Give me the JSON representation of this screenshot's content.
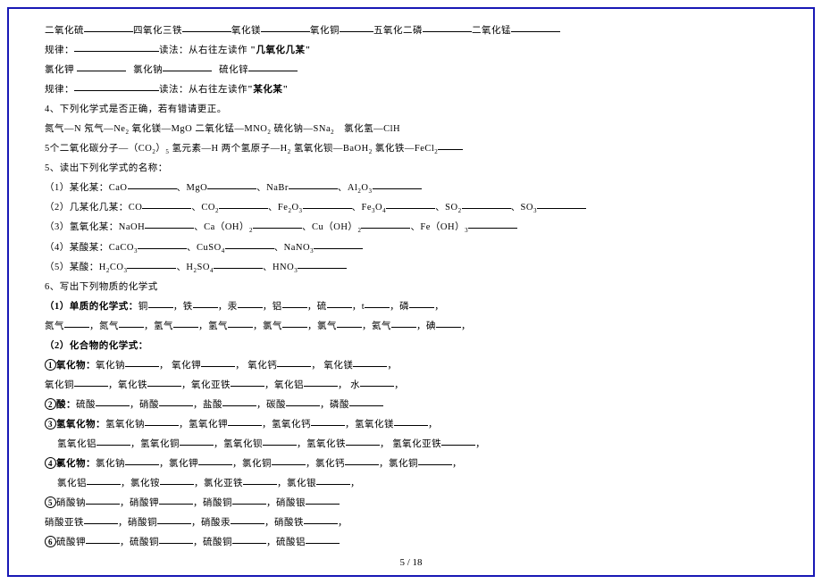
{
  "r1": {
    "a": "二氧化硫",
    "b": "四氧化三铁",
    "c": "氧化镁",
    "d": "氧化铜",
    "e": "五氧化二磷",
    "f": "二氧化锰"
  },
  "r2": {
    "a": "规律：",
    "b": "读法：从右往左读作",
    "c": "\"几氧化几某\""
  },
  "r3": {
    "a": "氯化钾",
    "b": "氯化钠",
    "c": "硫化锌"
  },
  "r4": {
    "a": "规律：",
    "b": "读法：从右往左读作",
    "c": "\"某化某\""
  },
  "r5": "4、下列化学式是否正确，若有错请更正。",
  "r6": {
    "a": "氮气—N",
    "b": "氖气—Ne",
    "c": "氧化镁—MgO",
    "d": "二氧化锰—MNO",
    "e": "硫化钠—SNa",
    "f": "氯化氢—ClH"
  },
  "r7": {
    "a": "5个二氧化碳分子—（CO",
    "b": "）",
    "c": " 氢元素—H 两个氢原子—H",
    "d": "氢氧化钡—BaOH",
    "e": "氯化铁—FeCl"
  },
  "r8": "5、读出下列化学式的名称：",
  "r9": {
    "a": "（1）某化某：CaO",
    "b": "、MgO",
    "c": "、NaBr",
    "d": "、Al",
    "e": "O"
  },
  "r10": {
    "a": "（2）几某化几某：CO",
    "b": "、CO",
    "c": "、Fe",
    "d": "O",
    "e": "、Fe",
    "f": "O",
    "g": "、SO",
    "h": "、SO"
  },
  "r11": {
    "a": "（3）氢氧化某：NaOH",
    "b": "、Ca（OH）",
    "c": "、Cu（OH）",
    "d": "、Fe（OH）"
  },
  "r12": {
    "a": "（4）某酸某：CaCO",
    "b": "、CuSO",
    "c": "、NaNO"
  },
  "r13": {
    "a": "（5）某酸：H",
    "b": "CO",
    "c": "、H",
    "d": "SO",
    "e": "、HNO"
  },
  "r14": "6、写出下列物质的化学式",
  "r15": {
    "a": "（1）单质的化学式：",
    "b": "铜",
    "c": "，铁",
    "d": "，汞",
    "e": "，铝",
    "f": "，硫",
    "g": "，t",
    "h": "，磷",
    "i": "，"
  },
  "r16": {
    "a": "氮气",
    "b": "，氮气",
    "c": "，氢气",
    "d": "，氢气",
    "e": "，氯气",
    "f": "，氯气",
    "g": "，氦气",
    "h": "，碘",
    "i": "，"
  },
  "r17": "（2）化合物的化学式：",
  "r18": {
    "a": "氧化物：",
    "b": "氧化钠",
    "c": "，  氧化钾",
    "d": "，  氧化钙",
    "e": "，     氧化镁",
    "f": "，"
  },
  "r19": {
    "a": "氧化铜",
    "b": "，氧化铁",
    "c": "，氧化亚铁",
    "d": "，氧化铝",
    "e": "，  水",
    "f": "，"
  },
  "r20": {
    "a": "酸：",
    "b": "硫酸",
    "c": "，硝酸",
    "d": "，盐酸",
    "e": "，碳酸",
    "f": "，磷酸"
  },
  "r21": {
    "a": "氢氧化物：",
    "b": "氢氧化钠",
    "c": "，氢氧化钾",
    "d": "，氢氧化钙",
    "e": "，氢氧化镁",
    "f": "，"
  },
  "r22": {
    "a": " 氢氧化铝",
    "b": "，氢氧化铜",
    "c": "，氢氧化钡",
    "d": "，氢氧化铁",
    "e": "，  氢氧化亚铁",
    "f": "，"
  },
  "r23": {
    "a": "氯化物：",
    "b": "氯化钠",
    "c": "，氯化钾",
    "d": "，氯化铜",
    "e": "，氯化钙",
    "f": "，氯化铜",
    "g": "，"
  },
  "r24": {
    "a": "  氯化铝",
    "b": "，氯化铵",
    "c": "，氯化亚铁",
    "d": "，氯化银",
    "e": "，"
  },
  "r25": {
    "a": "硝酸钠",
    "b": "，硝酸钾",
    "c": "，硝酸铜",
    "d": "，硝酸银"
  },
  "r26": {
    "a": "硝酸亚铁",
    "b": "，硝酸铜",
    "c": "，硝酸汞",
    "d": "，硝酸铁",
    "e": "，"
  },
  "r27": {
    "a": "硫酸钾",
    "b": "，硫酸铜",
    "c": "，硫酸铜",
    "d": "，硫酸铝"
  },
  "foot": "5 / 18"
}
